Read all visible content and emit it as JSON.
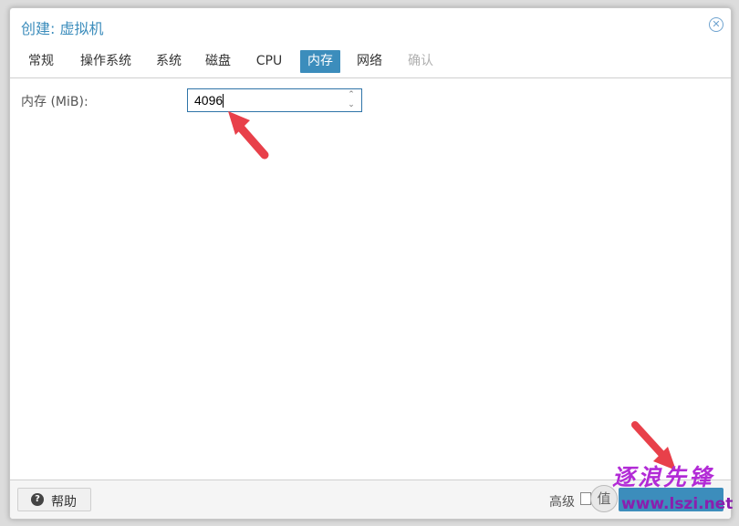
{
  "dialog": {
    "title": "创建: 虚拟机",
    "close_icon": "close-icon"
  },
  "tabs": [
    {
      "label": "常规"
    },
    {
      "label": "操作系统"
    },
    {
      "label": "系统"
    },
    {
      "label": "磁盘"
    },
    {
      "label": "CPU"
    },
    {
      "label": "内存",
      "active": true
    },
    {
      "label": "网络"
    },
    {
      "label": "确认",
      "disabled": true
    }
  ],
  "memory": {
    "label": "内存 (MiB):",
    "value": "4096"
  },
  "footer": {
    "help_label": "帮助",
    "help_icon": "question-circle-icon",
    "advanced_label": "高级"
  },
  "watermark": {
    "badge": "值",
    "text": "逐浪先锋",
    "url": "www.lszi.net"
  },
  "colors": {
    "accent": "#3c8dbc",
    "arrow": "#e8404a",
    "watermark": "#b22bd6"
  }
}
